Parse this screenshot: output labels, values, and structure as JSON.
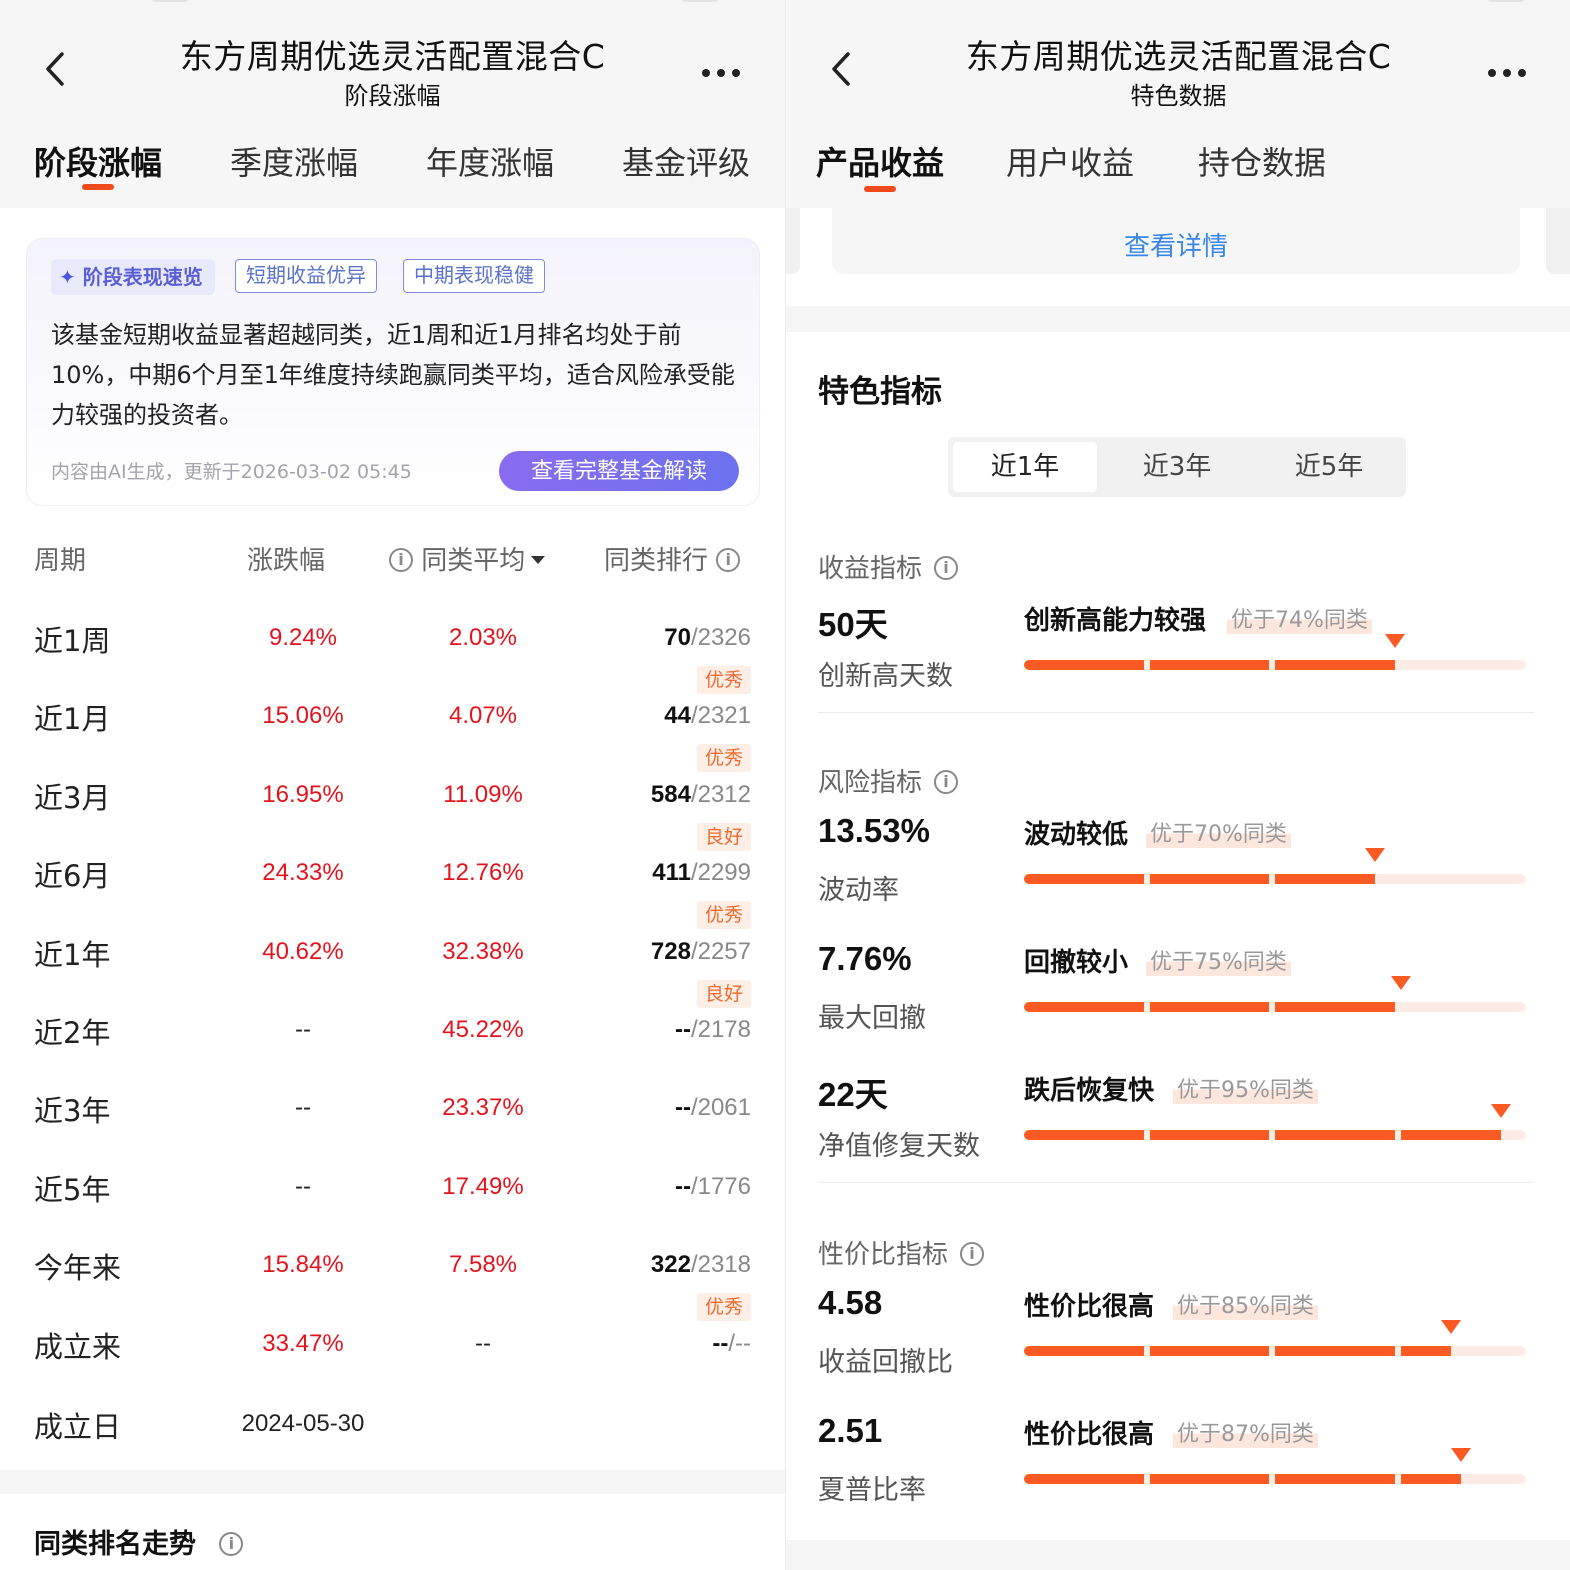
{
  "left": {
    "header": {
      "title": "东方周期优选灵活配置混合C",
      "subtitle": "阶段涨幅"
    },
    "tabs": [
      "阶段涨幅",
      "季度涨幅",
      "年度涨幅",
      "基金评级"
    ],
    "active_tab": "阶段涨幅",
    "ai_card": {
      "tag": "阶段表现速览",
      "chips": [
        "短期收益优异",
        "中期表现稳健"
      ],
      "text": "该基金短期收益显著超越同类，近1周和近1月排名均处于前10%，中期6个月至1年维度持续跑赢同类平均，适合风险承受能力较强的投资者。",
      "meta": "内容由AI生成，更新于2026-03-02 05:45",
      "button": "查看完整基金解读"
    },
    "table": {
      "headers": [
        "周期",
        "涨跌幅",
        "同类平均",
        "同类排行"
      ],
      "rows": [
        {
          "period": "近1周",
          "change": "9.24%",
          "avg": "2.03%",
          "rank": "70",
          "total": "/2326",
          "badge": "优秀"
        },
        {
          "period": "近1月",
          "change": "15.06%",
          "avg": "4.07%",
          "rank": "44",
          "total": "/2321",
          "badge": "优秀"
        },
        {
          "period": "近3月",
          "change": "16.95%",
          "avg": "11.09%",
          "rank": "584",
          "total": "/2312",
          "badge": "良好"
        },
        {
          "period": "近6月",
          "change": "24.33%",
          "avg": "12.76%",
          "rank": "411",
          "total": "/2299",
          "badge": "优秀"
        },
        {
          "period": "近1年",
          "change": "40.62%",
          "avg": "32.38%",
          "rank": "728",
          "total": "/2257",
          "badge": "良好"
        },
        {
          "period": "近2年",
          "change": "--",
          "avg": "45.22%",
          "rank": "--",
          "total": "/2178",
          "badge": ""
        },
        {
          "period": "近3年",
          "change": "--",
          "avg": "23.37%",
          "rank": "--",
          "total": "/2061",
          "badge": ""
        },
        {
          "period": "近5年",
          "change": "--",
          "avg": "17.49%",
          "rank": "--",
          "total": "/1776",
          "badge": ""
        },
        {
          "period": "今年来",
          "change": "15.84%",
          "avg": "7.58%",
          "rank": "322",
          "total": "/2318",
          "badge": "优秀"
        },
        {
          "period": "成立来",
          "change": "33.47%",
          "avg": "--",
          "rank": "--",
          "total": "/--",
          "badge": ""
        }
      ],
      "inception_label": "成立日",
      "inception_date": "2024-05-30"
    },
    "trend_title": "同类排名走势"
  },
  "right": {
    "header": {
      "title": "东方周期优选灵活配置混合C",
      "subtitle": "特色数据"
    },
    "tabs": [
      "产品收益",
      "用户收益",
      "持仓数据"
    ],
    "active_tab": "产品收益",
    "detail_link": "查看详情",
    "feature_title": "特色指标",
    "periods": [
      "近1年",
      "近3年",
      "近5年"
    ],
    "active_period": "近1年",
    "groups": [
      {
        "label": "收益指标",
        "metrics": [
          {
            "value": "50天",
            "name": "创新高天数",
            "desc": "创新高能力较强",
            "beat": "优于74%同类",
            "percentile": 74
          }
        ]
      },
      {
        "label": "风险指标",
        "metrics": [
          {
            "value": "13.53%",
            "name": "波动率",
            "desc": "波动较低",
            "beat": "优于70%同类",
            "percentile": 70
          },
          {
            "value": "7.76%",
            "name": "最大回撤",
            "desc": "回撤较小",
            "beat": "优于75%同类",
            "percentile": 75
          },
          {
            "value": "22天",
            "name": "净值修复天数",
            "desc": "跌后恢复快",
            "beat": "优于95%同类",
            "percentile": 95
          }
        ]
      },
      {
        "label": "性价比指标",
        "metrics": [
          {
            "value": "4.58",
            "name": "收益回撤比",
            "desc": "性价比很高",
            "beat": "优于85%同类",
            "percentile": 85
          },
          {
            "value": "2.51",
            "name": "夏普比率",
            "desc": "性价比很高",
            "beat": "优于87%同类",
            "percentile": 87
          }
        ]
      }
    ],
    "colors": {
      "accent": "#fa5b24",
      "track": "#fdece6",
      "link": "#3a86e8",
      "up": "#e5131b"
    }
  }
}
